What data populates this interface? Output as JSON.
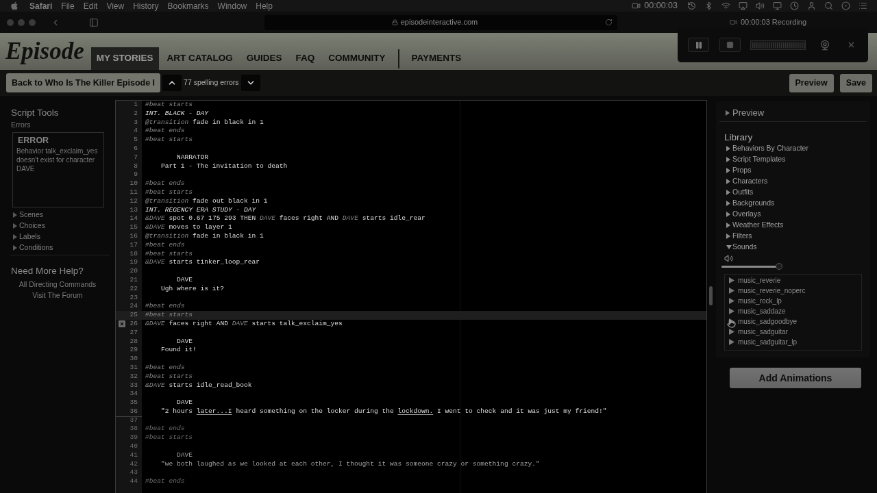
{
  "menu_bar": {
    "app": "Safari",
    "menus": [
      "File",
      "Edit",
      "View",
      "History",
      "Bookmarks",
      "Window",
      "Help"
    ],
    "clock": "00:00:03"
  },
  "browser": {
    "url": "episodeinteractive.com"
  },
  "recorder": {
    "status": "00:00:03 Recording"
  },
  "site_header": {
    "logo": "Episode",
    "tabs": [
      {
        "label": "MY STORIES",
        "selected": true,
        "separated": false
      },
      {
        "label": "ART CATALOG",
        "selected": false,
        "separated": false
      },
      {
        "label": "GUIDES",
        "selected": false,
        "separated": false
      },
      {
        "label": "FAQ",
        "selected": false,
        "separated": false
      },
      {
        "label": "COMMUNITY",
        "selected": false,
        "separated": false
      },
      {
        "label": "PAYMENTS",
        "selected": false,
        "separated": true
      }
    ]
  },
  "toolbar": {
    "back_button": "Back to Who Is The Killer Episode I",
    "spelling_errors": "77 spelling errors",
    "actions": [
      "Preview",
      "Save"
    ]
  },
  "script_tools": {
    "title": "Script Tools",
    "errors_heading": "Errors",
    "error": {
      "title": "ERROR",
      "message": "Behavior talk_exclaim_yes doesn't exist for character DAVE"
    },
    "sections": [
      {
        "label": "Scenes",
        "expanded": false
      },
      {
        "label": "Choices",
        "expanded": false
      },
      {
        "label": "Labels",
        "expanded": false
      },
      {
        "label": "Conditions",
        "expanded": false
      }
    ]
  },
  "help": {
    "title": "Need More Help?",
    "links": [
      "All Directing Commands",
      "Visit The Forum"
    ]
  },
  "editor": {
    "lines": [
      {
        "n": "1",
        "kind": "code",
        "parts": [
          {
            "text": "#beat starts",
            "kind": "tag"
          }
        ],
        "current": false,
        "error": false
      },
      {
        "n": "2",
        "kind": "code",
        "parts": [
          {
            "text": "INT. BLACK - DAY",
            "kind": "heading"
          }
        ],
        "current": false,
        "error": false
      },
      {
        "n": "3",
        "kind": "code",
        "parts": [
          {
            "text": "@transition",
            "kind": "tag"
          },
          {
            "text": "fade in black in 1",
            "kind": "plain"
          }
        ],
        "current": false,
        "error": false
      },
      {
        "n": "4",
        "kind": "code",
        "parts": [
          {
            "text": "#beat ends",
            "kind": "tag"
          }
        ],
        "current": false,
        "error": false
      },
      {
        "n": "5",
        "kind": "code",
        "parts": [
          {
            "text": "#beat starts",
            "kind": "tag"
          }
        ],
        "current": false,
        "error": false
      },
      {
        "n": "6",
        "current": false,
        "error": false
      },
      {
        "n": "7",
        "kind": "name",
        "parts": [
          {
            "text": "NARRATOR",
            "kind": "plain"
          }
        ],
        "current": false,
        "error": false
      },
      {
        "n": "8",
        "kind": "dialogue",
        "parts": [
          {
            "text": "Part 1 - The invitation to death",
            "kind": "plain"
          }
        ],
        "current": false,
        "error": false
      },
      {
        "n": "9",
        "current": false,
        "error": false
      },
      {
        "n": "10",
        "kind": "code",
        "parts": [
          {
            "text": "#beat ends",
            "kind": "tag"
          }
        ],
        "current": false,
        "error": false
      },
      {
        "n": "11",
        "kind": "code",
        "parts": [
          {
            "text": "#beat starts",
            "kind": "tag"
          }
        ],
        "current": false,
        "error": false
      },
      {
        "n": "12",
        "kind": "code",
        "parts": [
          {
            "text": "@transition",
            "kind": "tag"
          },
          {
            "text": "fade out black in 1",
            "kind": "plain"
          }
        ],
        "current": false,
        "error": false
      },
      {
        "n": "13",
        "kind": "code",
        "parts": [
          {
            "text": "INT. REGENCY ERA STUDY - DAY",
            "kind": "heading"
          }
        ],
        "current": false,
        "error": false
      },
      {
        "n": "14",
        "kind": "code",
        "parts": [
          {
            "text": "&DAVE",
            "kind": "tag"
          },
          {
            "text": "spot 0.67 175 293 THEN",
            "kind": "plain"
          },
          {
            "text": "DAVE",
            "kind": "tag"
          },
          {
            "text": "faces right AND",
            "kind": "plain"
          },
          {
            "text": "DAVE",
            "kind": "tag"
          },
          {
            "text": "starts idle_rear",
            "kind": "plain"
          }
        ],
        "current": false,
        "error": false
      },
      {
        "n": "15",
        "kind": "code",
        "parts": [
          {
            "text": "&DAVE",
            "kind": "tag"
          },
          {
            "text": "moves to layer 1",
            "kind": "plain"
          }
        ],
        "current": false,
        "error": false
      },
      {
        "n": "16",
        "kind": "code",
        "parts": [
          {
            "text": "@transition",
            "kind": "tag"
          },
          {
            "text": "fade in black in 1",
            "kind": "plain"
          }
        ],
        "current": false,
        "error": false
      },
      {
        "n": "17",
        "kind": "code",
        "parts": [
          {
            "text": "#beat ends",
            "kind": "tag"
          }
        ],
        "current": false,
        "error": false
      },
      {
        "n": "18",
        "kind": "code",
        "parts": [
          {
            "text": "#beat starts",
            "kind": "tag"
          }
        ],
        "current": false,
        "error": false
      },
      {
        "n": "19",
        "kind": "code",
        "parts": [
          {
            "text": "&DAVE",
            "kind": "tag"
          },
          {
            "text": "starts tinker_loop_rear",
            "kind": "plain"
          }
        ],
        "current": false,
        "error": false
      },
      {
        "n": "20",
        "current": false,
        "error": false
      },
      {
        "n": "21",
        "kind": "name",
        "parts": [
          {
            "text": "DAVE",
            "kind": "plain"
          }
        ],
        "current": false,
        "error": false
      },
      {
        "n": "22",
        "kind": "dialogue",
        "parts": [
          {
            "text": "Ugh where is it?",
            "kind": "plain"
          }
        ],
        "current": false,
        "error": false
      },
      {
        "n": "23",
        "current": false,
        "error": false
      },
      {
        "n": "24",
        "kind": "code",
        "parts": [
          {
            "text": "#beat ends",
            "kind": "tag"
          }
        ],
        "current": false,
        "error": false
      },
      {
        "n": "25",
        "kind": "code",
        "parts": [
          {
            "text": "#beat starts",
            "kind": "tag"
          }
        ],
        "current": true,
        "error": false
      },
      {
        "n": "26",
        "kind": "code",
        "parts": [
          {
            "text": "&DAVE",
            "kind": "tag"
          },
          {
            "text": "faces right AND",
            "kind": "plain"
          },
          {
            "text": "DAVE",
            "kind": "tag"
          },
          {
            "text": "starts talk_exclaim_yes",
            "kind": "plain"
          }
        ],
        "current": false,
        "error": true
      },
      {
        "n": "27",
        "current": false,
        "error": false
      },
      {
        "n": "28",
        "kind": "name",
        "parts": [
          {
            "text": "DAVE",
            "kind": "plain"
          }
        ],
        "current": false,
        "error": false
      },
      {
        "n": "29",
        "kind": "dialogue",
        "parts": [
          {
            "text": "Found it!",
            "kind": "plain"
          }
        ],
        "current": false,
        "error": false
      },
      {
        "n": "30",
        "current": false,
        "error": false
      },
      {
        "n": "31",
        "kind": "code",
        "parts": [
          {
            "text": "#beat ends",
            "kind": "tag"
          }
        ],
        "current": false,
        "error": false
      },
      {
        "n": "32",
        "kind": "code",
        "parts": [
          {
            "text": "#beat starts",
            "kind": "tag"
          }
        ],
        "current": false,
        "error": false
      },
      {
        "n": "33",
        "kind": "code",
        "parts": [
          {
            "text": "&DAVE",
            "kind": "tag"
          },
          {
            "text": "starts idle_read_book",
            "kind": "plain"
          }
        ],
        "current": false,
        "error": false
      },
      {
        "n": "34",
        "current": false,
        "error": false
      },
      {
        "n": "35",
        "kind": "name",
        "parts": [
          {
            "text": "DAVE",
            "kind": "plain"
          }
        ],
        "current": false,
        "error": false
      },
      {
        "n": "36",
        "kind": "dialogue",
        "parts": [
          {
            "text": "\"2 hours",
            "kind": "plain"
          },
          {
            "text": "later...I",
            "kind": "misspelled"
          },
          {
            "text": "heard something on the locker during the",
            "kind": "plain"
          },
          {
            "text": "lockdown.",
            "kind": "misspelled"
          },
          {
            "text": "I went to check and it was just my friend!\"",
            "kind": "plain"
          }
        ],
        "current": false,
        "error": false
      }
    ],
    "faded_lines": [
      {
        "n": "37"
      },
      {
        "n": "38",
        "kind": "code",
        "parts": [
          {
            "text": "#beat ends",
            "kind": "tag"
          }
        ]
      },
      {
        "n": "39",
        "kind": "code",
        "parts": [
          {
            "text": "#beat starts",
            "kind": "tag"
          }
        ]
      },
      {
        "n": "40"
      },
      {
        "n": "41",
        "kind": "name",
        "parts": [
          {
            "text": "DAVE",
            "kind": "plain"
          }
        ]
      },
      {
        "n": "42",
        "kind": "dialogue",
        "parts": [
          {
            "text": "\"we both laughed as we looked at each other, I thought it was someone crazy or something crazy.\"",
            "kind": "plain"
          }
        ]
      },
      {
        "n": "43"
      },
      {
        "n": "44",
        "kind": "code",
        "parts": [
          {
            "text": "#beat ends",
            "kind": "tag"
          }
        ]
      }
    ]
  },
  "preview": {
    "label": "Preview",
    "expanded": false
  },
  "library": {
    "title": "Library",
    "sections": [
      {
        "label": "Behaviors By Character",
        "expanded": false
      },
      {
        "label": "Script Templates",
        "expanded": false
      },
      {
        "label": "Props",
        "expanded": false
      },
      {
        "label": "Characters",
        "expanded": false
      },
      {
        "label": "Outfits",
        "expanded": false
      },
      {
        "label": "Backgrounds",
        "expanded": false
      },
      {
        "label": "Overlays",
        "expanded": false
      },
      {
        "label": "Weather Effects",
        "expanded": false
      },
      {
        "label": "Filters",
        "expanded": false
      },
      {
        "label": "Sounds",
        "expanded": true
      }
    ],
    "volume": {
      "level": 0.95
    },
    "sounds": [
      {
        "name": "music_reverie",
        "hovered": false
      },
      {
        "name": "music_reverie_noperc",
        "hovered": false
      },
      {
        "name": "music_rock_lp",
        "hovered": false
      },
      {
        "name": "music_saddaze",
        "hovered": false
      },
      {
        "name": "music_sadgoodbye",
        "hovered": true
      },
      {
        "name": "music_sadguitar",
        "hovered": false
      },
      {
        "name": "music_sadguitar_lp",
        "hovered": false
      }
    ],
    "add_button": "Add Animations"
  }
}
